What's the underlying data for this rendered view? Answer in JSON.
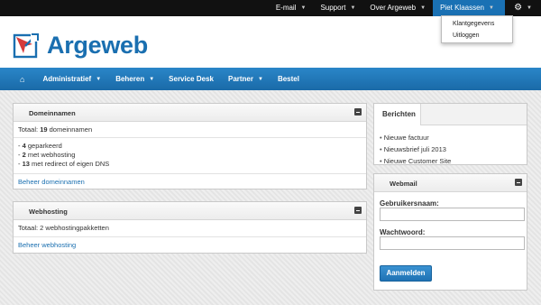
{
  "topbar": {
    "items": [
      {
        "label": "E-mail"
      },
      {
        "label": "Support"
      },
      {
        "label": "Over Argeweb"
      },
      {
        "label": "Piet Klaassen"
      }
    ],
    "dropdown": [
      "Klantgegevens",
      "Uitloggen"
    ],
    "active_color": "#1a71b4"
  },
  "brand": {
    "name": "Argeweb",
    "color": "#1a6fb0"
  },
  "nav": {
    "items": [
      {
        "label": "Administratief",
        "has_caret": true
      },
      {
        "label": "Beheren",
        "has_caret": true
      },
      {
        "label": "Service Desk",
        "has_caret": false
      },
      {
        "label": "Partner",
        "has_caret": true
      },
      {
        "label": "Bestel",
        "has_caret": false
      }
    ]
  },
  "domeinnamen": {
    "title": "Domeinnamen",
    "total_prefix": "Totaal: ",
    "total_count": "19",
    "total_suffix": " domeinnamen",
    "lines": [
      {
        "dash": "- ",
        "count": "4",
        "text": " geparkeerd"
      },
      {
        "dash": "- ",
        "count": "2",
        "text": " met webhosting"
      },
      {
        "dash": "- ",
        "count": "13",
        "text": " met redirect of eigen DNS"
      }
    ],
    "link": "Beheer domeinnamen"
  },
  "webhosting": {
    "title": "Webhosting",
    "total": "Totaal: 2 webhostingpakketten",
    "link": "Beheer webhosting"
  },
  "berichten": {
    "tab": "Berichten",
    "items": [
      "Nieuwe factuur",
      "Nieuwsbrief juli 2013",
      "Nieuwe Customer Site"
    ]
  },
  "webmail": {
    "title": "Webmail",
    "username_label": "Gebruikersnaam:",
    "username_value": "",
    "password_label": "Wachtwoord:",
    "password_value": "",
    "submit": "Aanmelden"
  }
}
